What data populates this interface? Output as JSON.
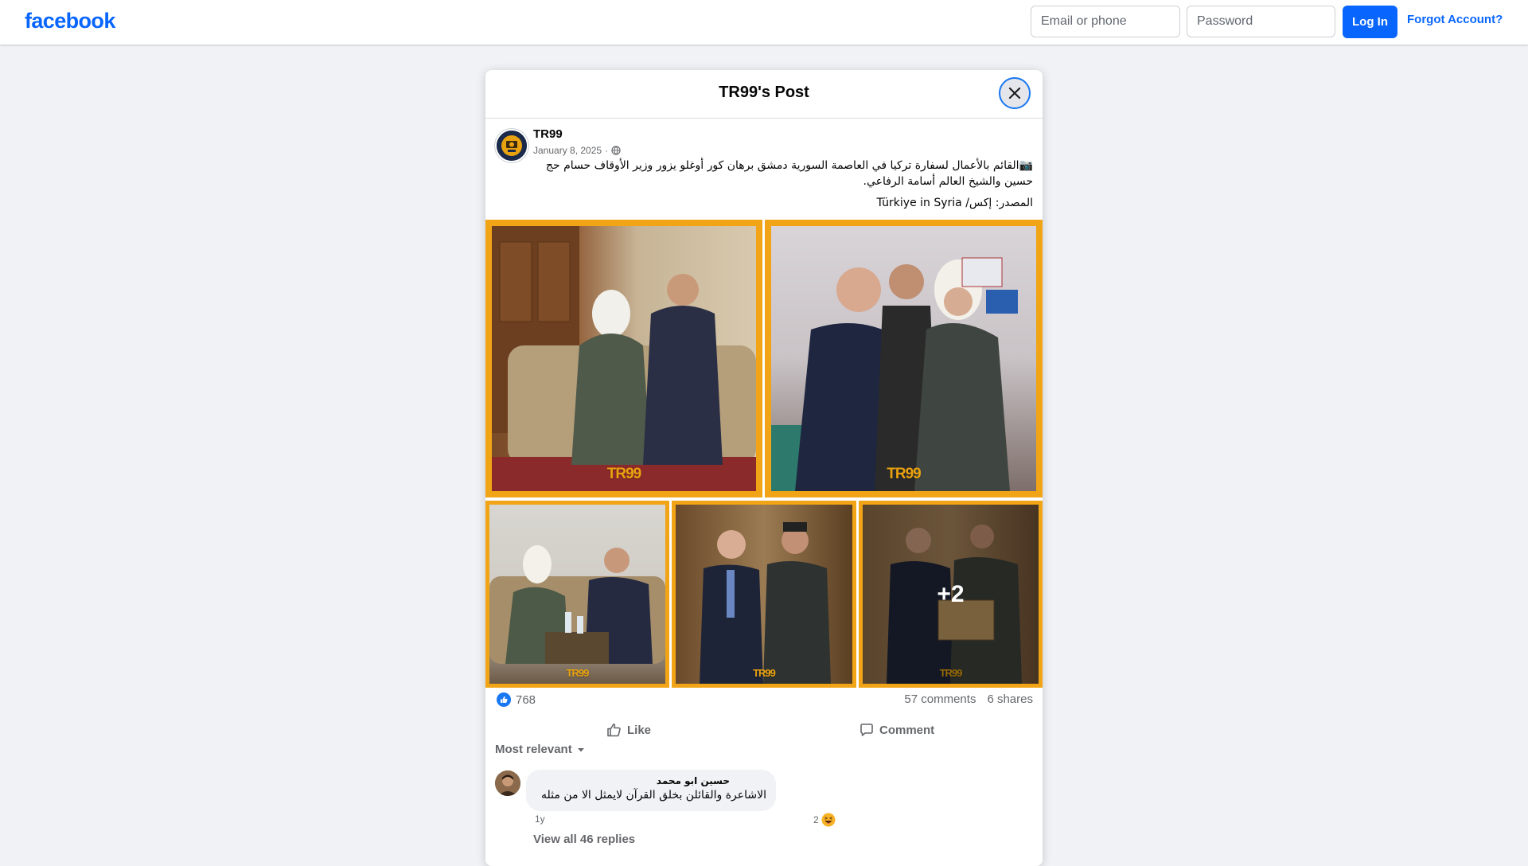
{
  "header": {
    "logo": "facebook",
    "email_placeholder": "Email or phone",
    "password_placeholder": "Password",
    "login_label": "Log In",
    "forgot_label": "Forgot Account?"
  },
  "dialog": {
    "title": "TR99's Post",
    "close_icon": "close-icon"
  },
  "post": {
    "author": "TR99",
    "date": "January 8, 2025",
    "separator": "·",
    "privacy_icon": "globe-icon",
    "text_line1": "📷القائم بالأعمال لسفارة تركيا في العاصمة السورية دمشق برهان كور أوغلو يزور وزير الأوقاف حسام حج حسين والشيخ العالم أسامة الرفاعي.",
    "text_source": "المصدر: إكس/ Türkiye in Syria",
    "photos": [
      {
        "watermark": "TR99"
      },
      {
        "watermark": "TR99"
      },
      {
        "watermark": "TR99"
      },
      {
        "watermark": "TR99"
      },
      {
        "watermark": "TR99",
        "more_label": "+2"
      }
    ],
    "reactions_count": "768",
    "comments_count": "57 comments",
    "shares_count": "6 shares",
    "like_label": "Like",
    "comment_label": "Comment"
  },
  "comments": {
    "sort_label": "Most relevant",
    "items": [
      {
        "name": "حسين ابو محمد",
        "text": "الاشاعرة والقائلن بخلق القرآن لايمثل الا من مثله",
        "time": "1y",
        "reaction_count": "2",
        "view_replies": "View all 46 replies"
      }
    ]
  },
  "colors": {
    "brand": "#0866ff",
    "photo_frame": "#f0a416",
    "background": "#f0f2f5"
  }
}
